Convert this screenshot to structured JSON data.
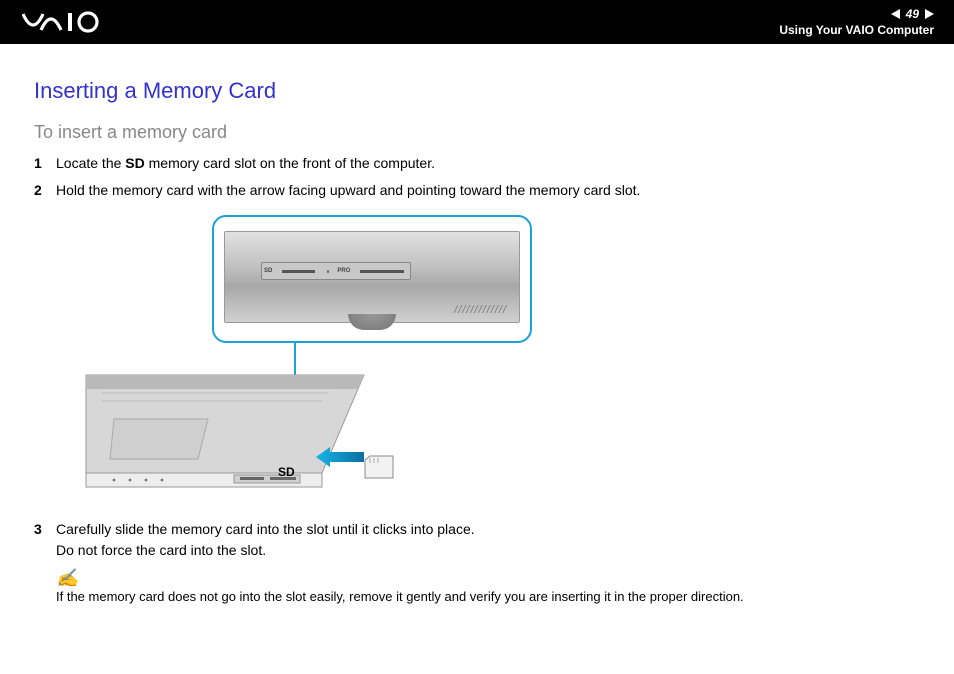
{
  "header": {
    "page_number": "49",
    "section": "Using Your VAIO Computer"
  },
  "heading_main": "Inserting a Memory Card",
  "heading_sub": "To insert a memory card",
  "steps": [
    {
      "num": "1",
      "pre": "Locate the ",
      "bold": "SD",
      "post": " memory card slot on the front of the computer."
    },
    {
      "num": "2",
      "pre": "Hold the memory card with the arrow facing upward and pointing toward the memory card slot.",
      "bold": "",
      "post": ""
    },
    {
      "num": "3",
      "pre": "Carefully slide the memory card into the slot until it clicks into place.",
      "bold": "",
      "post": "",
      "line2": "Do not force the card into the slot."
    }
  ],
  "figure": {
    "slot_sd_label": "SD",
    "slot_pro_label": "PRO",
    "sd_callout": "SD"
  },
  "note": {
    "icon": "✍",
    "text": "If the memory card does not go into the slot easily, remove it gently and verify you are inserting it in the proper direction."
  }
}
